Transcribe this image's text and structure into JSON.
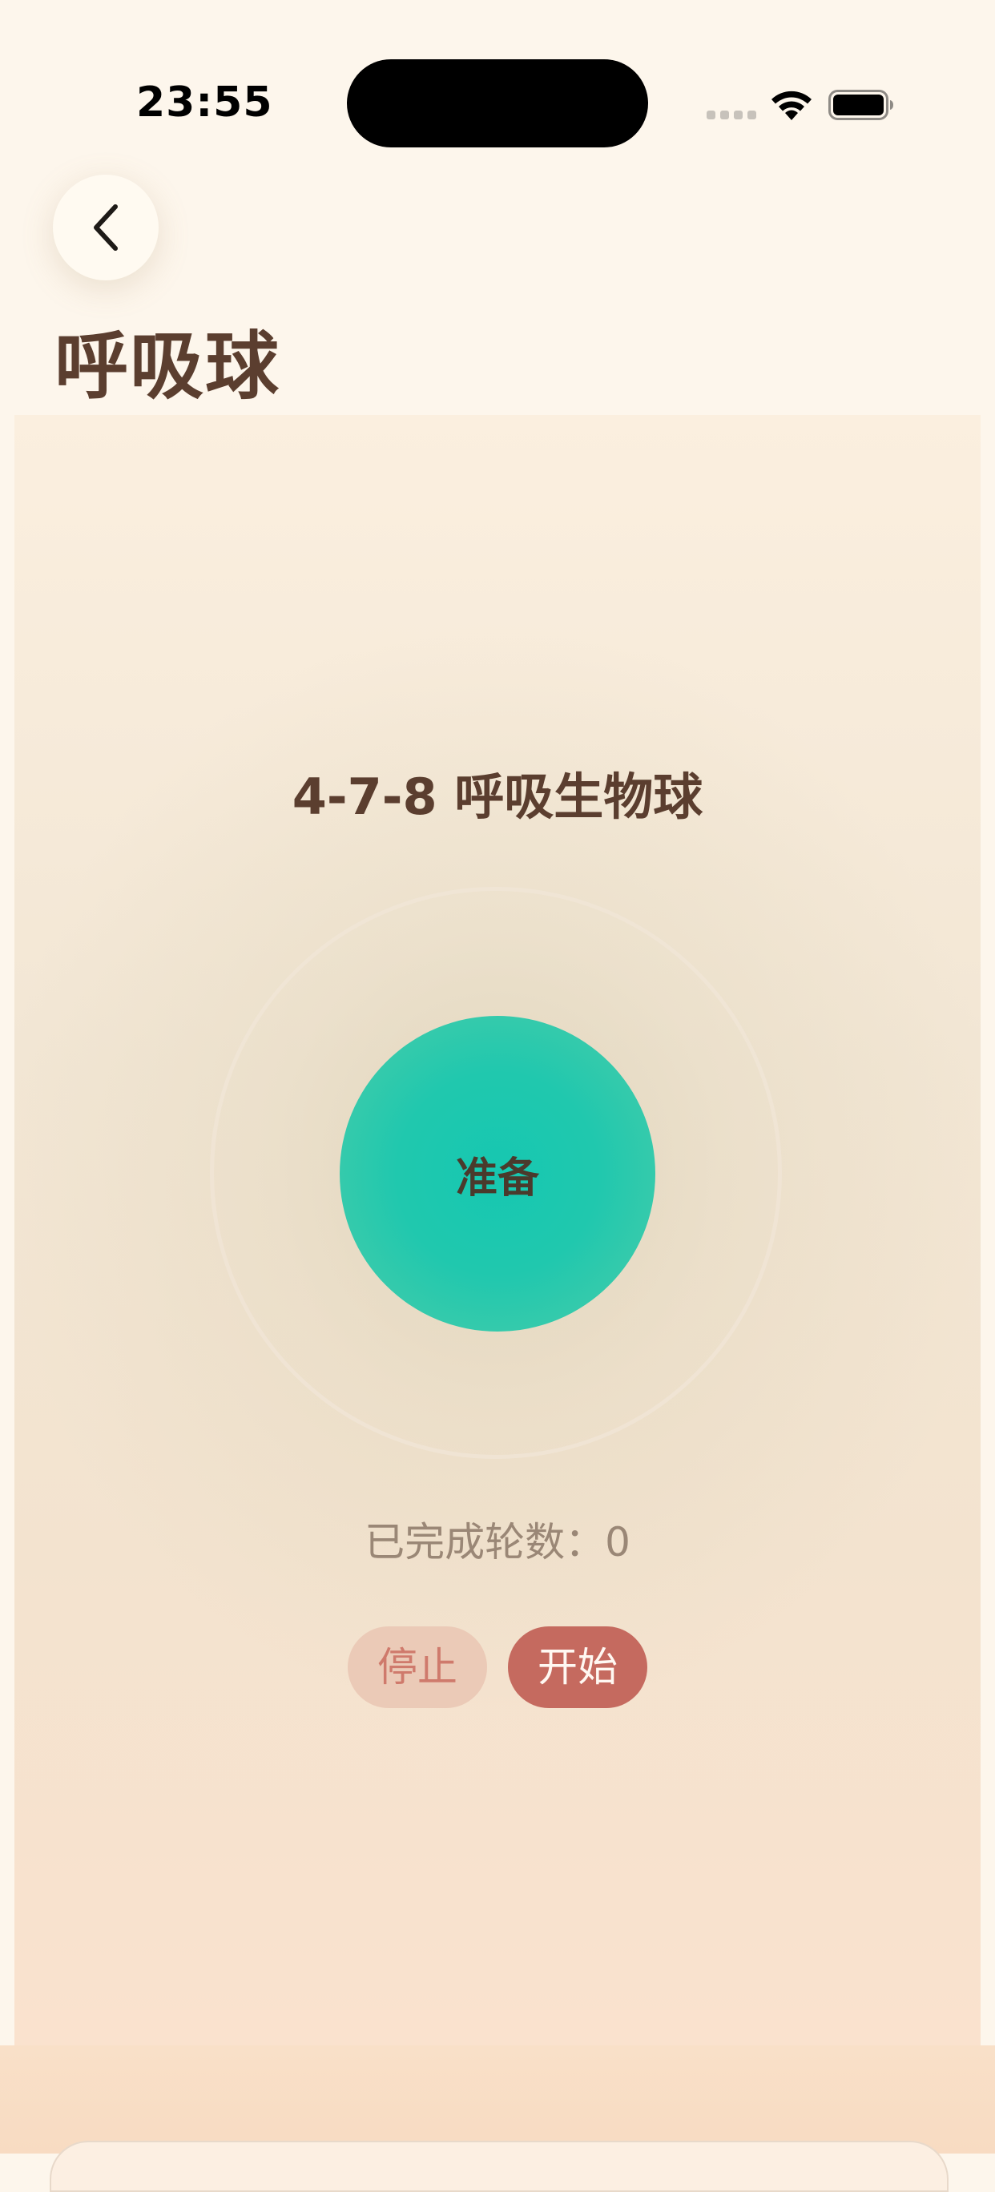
{
  "status_bar": {
    "time": "23:55"
  },
  "header": {
    "title": "呼吸球"
  },
  "exercise": {
    "title": "4-7-8 呼吸生物球",
    "phase": "准备",
    "rounds_label": "已完成轮数：",
    "rounds_value": "0"
  },
  "controls": {
    "stop_label": "停止",
    "start_label": "开始"
  },
  "colors": {
    "background": "#FDF6EC",
    "title_text": "#5B3E2F",
    "ball": "#1CC7AF",
    "start_button": "#C56A5F",
    "stop_button": "#EBCAB7"
  },
  "icons": {
    "back": "chevron-left-icon",
    "wifi": "wifi-icon",
    "battery": "battery-icon"
  }
}
